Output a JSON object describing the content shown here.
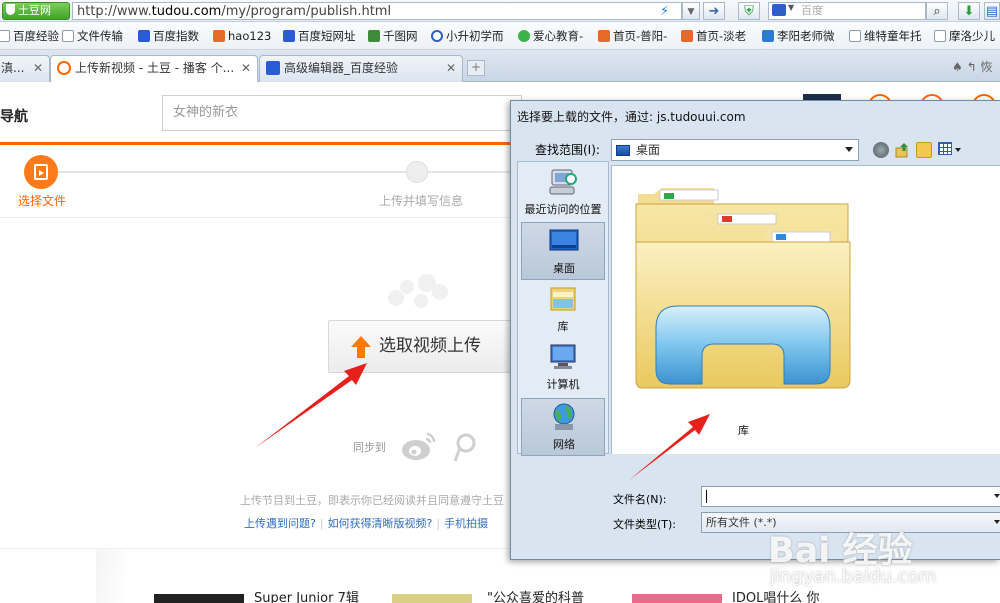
{
  "browser": {
    "site_badge": "土豆网",
    "url_scheme": "http://www.",
    "url_host": "tudou.com",
    "url_path": "/my/program/publish.html",
    "search_placeholder": "百度",
    "bookmarks": [
      {
        "label": "百度经验",
        "icon": "page-icon"
      },
      {
        "label": "文件传输",
        "icon": "page-icon"
      },
      {
        "label": "百度指数",
        "icon": "paw-icon"
      },
      {
        "label": "hao123",
        "icon": "hao123-icon"
      },
      {
        "label": "百度短网址",
        "icon": "paw-icon"
      },
      {
        "label": "千图网",
        "icon": "qiantu-icon"
      },
      {
        "label": "小升初学而",
        "icon": "play-icon"
      },
      {
        "label": "爱心教育-",
        "icon": "chat-icon"
      },
      {
        "label": "首页-普阳-",
        "icon": "orange-icon"
      },
      {
        "label": "首页-淡老",
        "icon": "orange-icon"
      },
      {
        "label": "李阳老师微",
        "icon": "p-icon"
      },
      {
        "label": "维特童年托",
        "icon": "page-icon"
      },
      {
        "label": "摩洛少儿",
        "icon": "page-icon"
      }
    ],
    "tabs": [
      {
        "label": "滇...",
        "active": false
      },
      {
        "label": "上传新视频 - 土豆 - 播客 个...",
        "active": true
      },
      {
        "label": "高级编辑器_百度经验",
        "active": false
      }
    ],
    "new_tab": "+",
    "tab_tools": "♠ ↰ 恢"
  },
  "page": {
    "nav_label": "导航",
    "search_placeholder": "女神的新衣",
    "steps": [
      {
        "label": "选择文件",
        "active": true
      },
      {
        "label": "上传并填写信息",
        "active": false
      }
    ],
    "upload_button": "选取视频上传",
    "sync_label": "同步到",
    "agree_text": "上传节目到土豆，即表示你已经阅读并且同意遵守土豆",
    "help_links": [
      "上传遇到问题?",
      "如何获得清晰版视频?",
      "手机拍摄"
    ],
    "bottom_items": [
      "Super Junior 7辑",
      "\"公众喜爱的科普",
      "IDOL唱什么  你"
    ]
  },
  "dialog": {
    "title": "选择要上载的文件，通过: js.tudouui.com",
    "lookin_label": "查找范围(I):",
    "lookin_value": "桌面",
    "places": [
      {
        "label": "最近访问的位置",
        "icon": "recent-places-icon",
        "selected": false
      },
      {
        "label": "桌面",
        "icon": "desktop-icon",
        "selected": true
      },
      {
        "label": "库",
        "icon": "libraries-icon",
        "selected": false
      },
      {
        "label": "计算机",
        "icon": "computer-icon",
        "selected": false
      },
      {
        "label": "网络",
        "icon": "network-icon",
        "selected": true
      }
    ],
    "file_item": "库",
    "filename_label": "文件名(N):",
    "filename_value": "",
    "filetype_label": "文件类型(T):",
    "filetype_value": "所有文件 (*.*)"
  },
  "watermark": {
    "logo": "Bai 经验",
    "url": "jingyan.baidu.com"
  },
  "colors": {
    "accent_orange": "#ff6600",
    "annotation_red": "#e8201c",
    "link_blue": "#2f6cc4"
  }
}
